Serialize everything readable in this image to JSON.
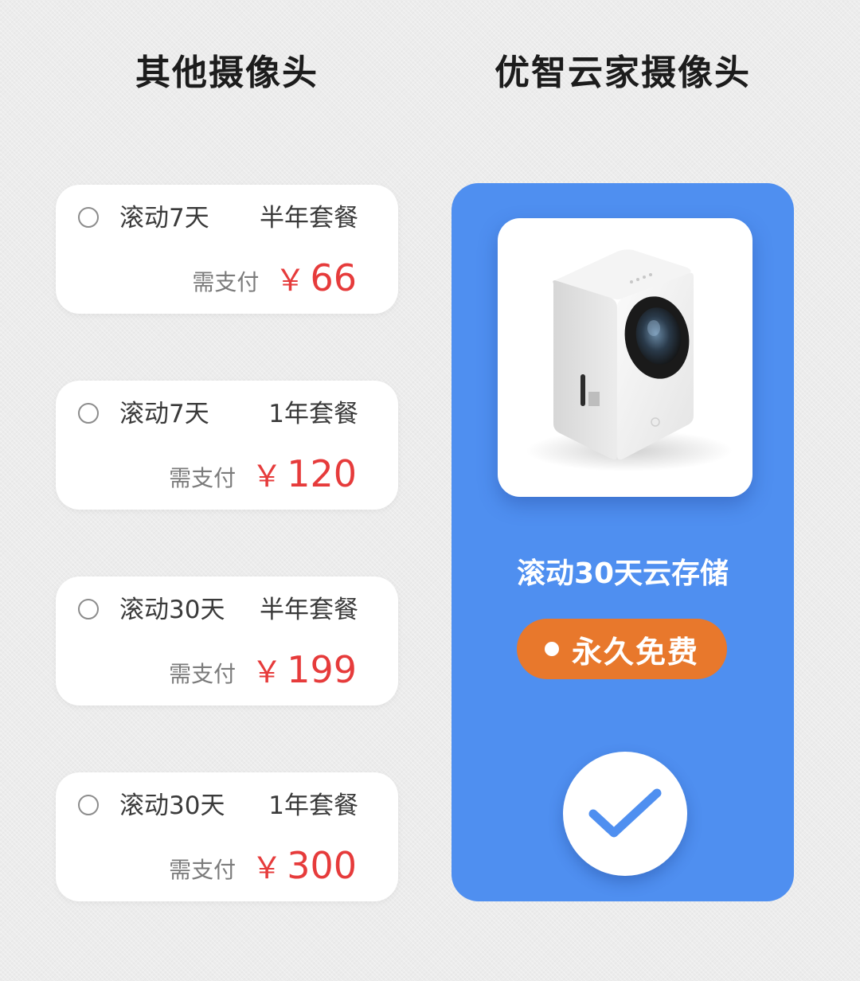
{
  "columns": {
    "left_title": "其他摄像头",
    "right_title": "优智云家摄像头"
  },
  "plans": [
    {
      "duration": "滚动7天",
      "package": "半年套餐",
      "pay_label": "需支付",
      "currency": "￥",
      "price": "66"
    },
    {
      "duration": "滚动7天",
      "package": "1年套餐",
      "pay_label": "需支付",
      "currency": "￥",
      "price": "120"
    },
    {
      "duration": "滚动30天",
      "package": "半年套餐",
      "pay_label": "需支付",
      "currency": "￥",
      "price": "199"
    },
    {
      "duration": "滚动30天",
      "package": "1年套餐",
      "pay_label": "需支付",
      "currency": "￥",
      "price": "300"
    }
  ],
  "premium": {
    "storage_title": "滚动30天云存储",
    "badge": "永久免费",
    "icons": {
      "product": "camera-product-image",
      "check": "check-icon"
    }
  },
  "colors": {
    "accent_blue": "#4f8ff0",
    "price_red": "#e63b3b",
    "badge_orange": "#e8782c",
    "background": "#ececec"
  }
}
